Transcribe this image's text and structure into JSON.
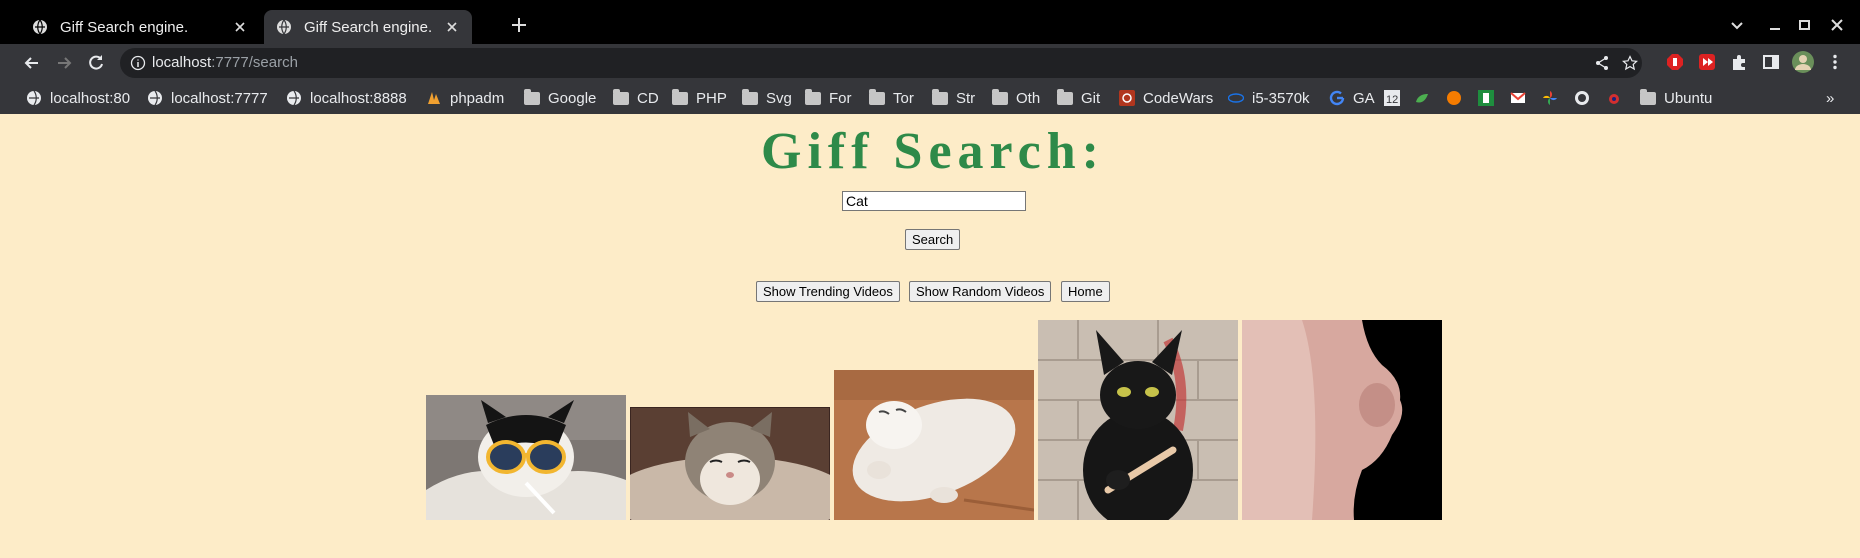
{
  "browser": {
    "tabs": [
      {
        "title": "Giff Search engine."
      },
      {
        "title": "Giff Search engine."
      }
    ],
    "url": {
      "host": "localhost",
      "rest": ":7777/search"
    },
    "bookmarks": [
      "localhost:80",
      "localhost:7777",
      "localhost:8888",
      "phpadm",
      "Google",
      "CD",
      "PHP",
      "Svg",
      "For",
      "Tor",
      "Str",
      "Oth",
      "Git",
      "CodeWars",
      "i5-3570k",
      "GA",
      "Ubuntu"
    ],
    "bookmarks_more": "»"
  },
  "page": {
    "title": "Giff Search:",
    "search_value": "Cat",
    "search_button": "Search",
    "trending_button": "Show Trending Videos",
    "random_button": "Show Random Videos",
    "home_button": "Home"
  },
  "colors": {
    "background": "#fdecc8",
    "title": "#2e8a49"
  },
  "gifs": [
    {
      "subject": "cat with sunglasses and cigarette"
    },
    {
      "subject": "fluffy cat squinting"
    },
    {
      "subject": "white cat rolling on floor"
    },
    {
      "subject": "black cat holding nail file"
    },
    {
      "subject": "close-up cat face on black"
    }
  ]
}
